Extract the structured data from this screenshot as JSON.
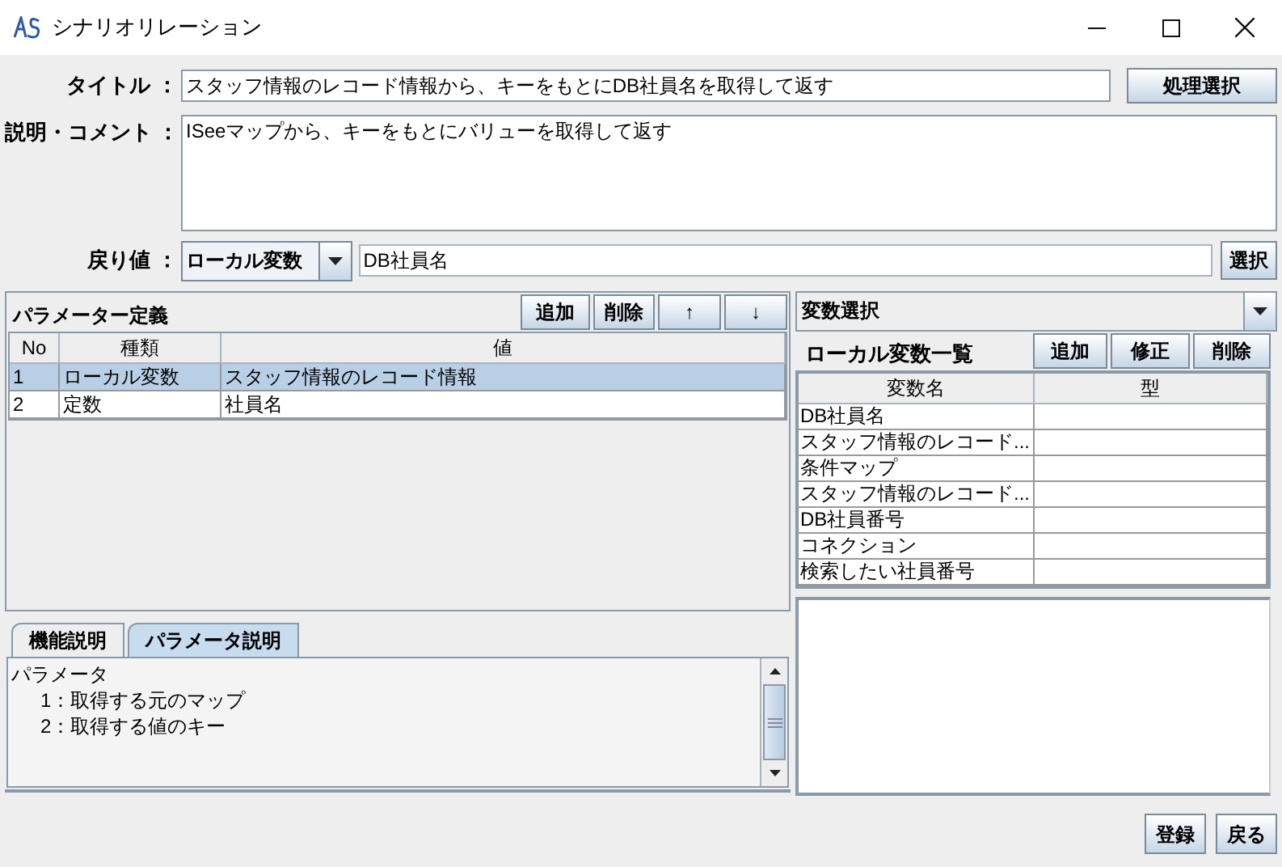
{
  "window": {
    "title": "シナリオリレーション"
  },
  "form": {
    "title_label": "タイトル ：",
    "title_value": "スタッフ情報のレコード情報から、キーをもとにDB社員名を取得して返す",
    "process_button": "処理選択",
    "description_label": "説明・コメント ：",
    "description_value": "ISeeマップから、キーをもとにバリューを取得して返す",
    "return_label": "戻り値 ：",
    "return_type": "ローカル変数",
    "return_value": "DB社員名",
    "select_button": "選択"
  },
  "parameters": {
    "title": "パラメーター定義",
    "buttons": [
      "追加",
      "削除",
      "↑",
      "↓"
    ],
    "columns": [
      "No",
      "種類",
      "値"
    ],
    "rows": [
      {
        "cells": [
          "1",
          "ローカル変数",
          "スタッフ情報のレコード情報"
        ],
        "selected": true
      },
      {
        "cells": [
          "2",
          "定数",
          "社員名"
        ],
        "selected": false
      }
    ]
  },
  "help": {
    "tabs": [
      {
        "label": "機能説明",
        "selected": false
      },
      {
        "label": "パラメータ説明",
        "selected": true
      }
    ],
    "lines": [
      {
        "kind": "heading",
        "text": "パラメータ"
      },
      {
        "kind": "item",
        "text": "1：取得する元のマップ"
      },
      {
        "kind": "item",
        "text": "2：取得する値のキー"
      }
    ]
  },
  "variables": {
    "selector": "変数選択",
    "title": "ローカル変数一覧",
    "buttons": [
      "追加",
      "修正",
      "削除"
    ],
    "columns": [
      "変数名",
      "型"
    ],
    "rows": [
      {
        "name": "DB社員名"
      },
      {
        "name": "スタッフ情報のレコード..."
      },
      {
        "name": "条件マップ"
      },
      {
        "name": "スタッフ情報のレコード..."
      },
      {
        "name": "DB社員番号"
      },
      {
        "name": "コネクション"
      },
      {
        "name": "検索したい社員番号"
      }
    ]
  },
  "footer_buttons": [
    "登録",
    "戻る"
  ]
}
